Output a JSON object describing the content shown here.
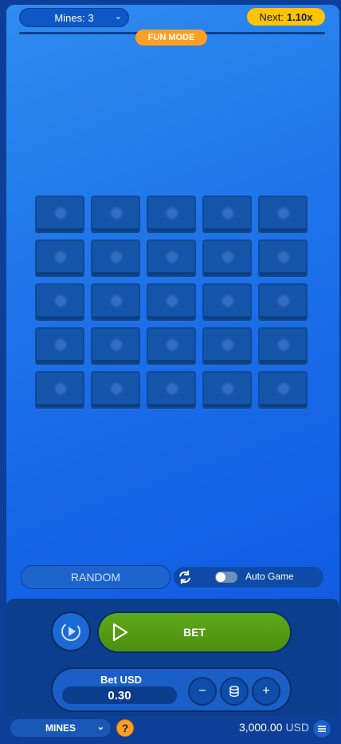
{
  "top": {
    "mines_select": "Mines: 3",
    "next_label": "Next:",
    "next_multiplier": "1.10x",
    "mode_badge": "FUN MODE"
  },
  "board": {
    "rows": 5,
    "cols": 5,
    "tile_state": "hidden"
  },
  "controls": {
    "random_label": "RANDOM",
    "auto_game_label": "Auto Game",
    "auto_game_enabled": false,
    "bet_button_label": "BET",
    "bet_amount_label": "Bet USD",
    "bet_amount_value": "0.30",
    "minus_label": "−",
    "plus_label": "+"
  },
  "footer": {
    "game_select": "MINES",
    "help_label": "?",
    "balance_value": "3,000.00",
    "balance_currency": "USD"
  },
  "colors": {
    "accent_yellow": "#ffc300",
    "accent_orange": "#ff9f24",
    "bet_green": "#5ea81a",
    "background_blue": "#1f74ea"
  },
  "icons": {
    "chevron": "chevron-down-icon",
    "refresh": "refresh-icon",
    "replay": "replay-icon",
    "play": "play-icon",
    "coins": "coins-icon",
    "menu": "menu-icon"
  }
}
